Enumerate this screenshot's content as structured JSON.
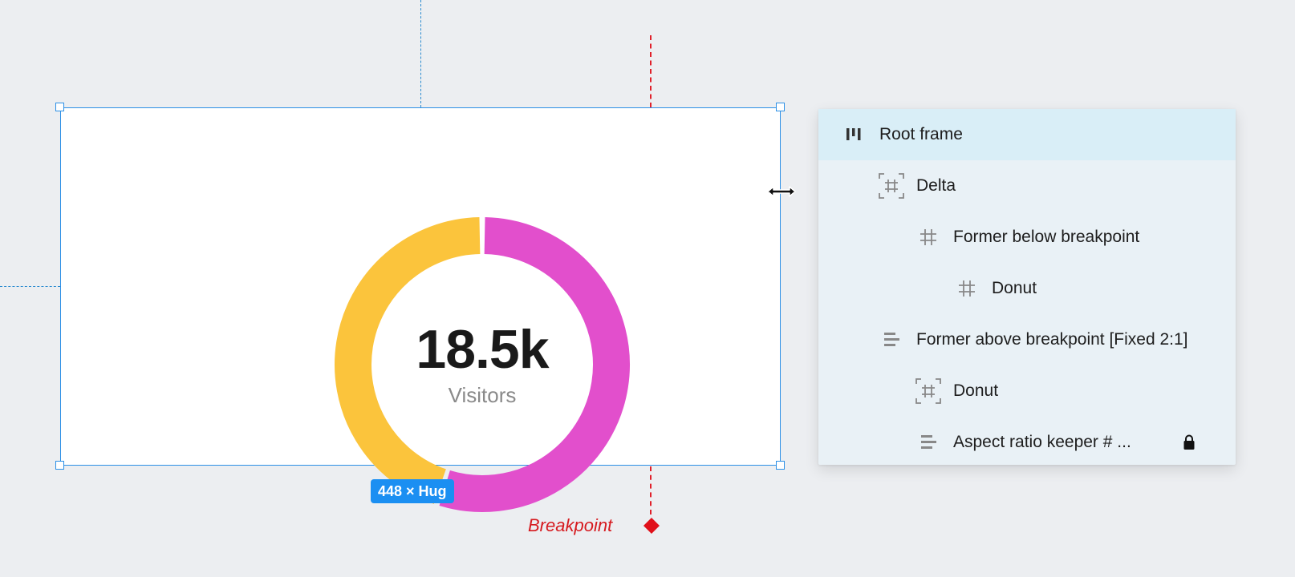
{
  "canvas": {
    "donut": {
      "value": "18.5k",
      "label": "Visitors"
    },
    "size_badge": "448 × Hug",
    "breakpoint_label": "Breakpoint"
  },
  "layers": {
    "items": [
      {
        "label": "Root frame",
        "icon": "auto-layout-horizontal-icon",
        "selected": true
      },
      {
        "label": "Delta",
        "icon": "frame-dashed-icon"
      },
      {
        "label": "Former below breakpoint",
        "icon": "frame-icon"
      },
      {
        "label": "Donut",
        "icon": "frame-icon"
      },
      {
        "label": "Former above breakpoint [Fixed 2:1]",
        "icon": "auto-layout-vertical-icon"
      },
      {
        "label": "Donut",
        "icon": "frame-dashed-icon"
      },
      {
        "label": "Aspect ratio keeper # ...",
        "icon": "auto-layout-vertical-icon",
        "locked": true
      }
    ]
  },
  "chart_data": {
    "type": "pie",
    "categories": [
      "",
      ""
    ],
    "values": [
      55,
      45
    ],
    "colors": [
      "#e24fcc",
      "#fbc43c"
    ]
  },
  "colors": {
    "selection": "#2b8fe6",
    "breakpoint": "#e0202a",
    "badge": "#1b8ff2"
  }
}
